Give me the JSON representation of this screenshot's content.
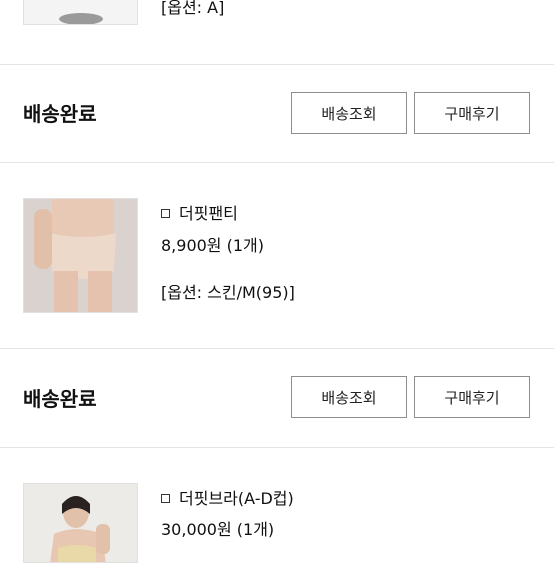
{
  "orders": [
    {
      "option": "[옵션: A]"
    },
    {
      "status": "배송완료",
      "track_label": "배송조회",
      "review_label": "구매후기",
      "product": {
        "name": "더핏팬티",
        "price": "8,900원 (1개)",
        "option": "[옵션: 스킨/M(95)]"
      }
    },
    {
      "status": "배송완료",
      "track_label": "배송조회",
      "review_label": "구매후기",
      "product": {
        "name": "더핏브라(A-D컵)",
        "price": "30,000원 (1개)"
      }
    }
  ]
}
